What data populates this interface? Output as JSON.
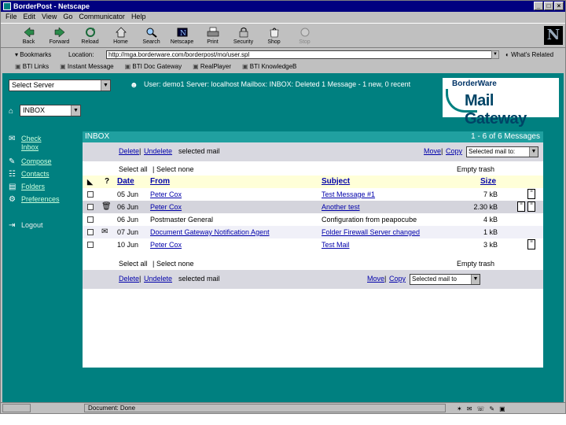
{
  "window": {
    "title": "BorderPost - Netscape"
  },
  "menubar": [
    "File",
    "Edit",
    "View",
    "Go",
    "Communicator",
    "Help"
  ],
  "toolbar": [
    {
      "label": "Back",
      "icon": "back-arrow-icon"
    },
    {
      "label": "Forward",
      "icon": "forward-arrow-icon"
    },
    {
      "label": "Reload",
      "icon": "reload-icon"
    },
    {
      "label": "Home",
      "icon": "home-icon"
    },
    {
      "label": "Search",
      "icon": "search-icon"
    },
    {
      "label": "Netscape",
      "icon": "netscape-icon"
    },
    {
      "label": "Print",
      "icon": "print-icon"
    },
    {
      "label": "Security",
      "icon": "security-icon"
    },
    {
      "label": "Shop",
      "icon": "shop-icon"
    },
    {
      "label": "Stop",
      "icon": "stop-icon",
      "disabled": true
    }
  ],
  "location": {
    "bookmarks": "Bookmarks",
    "label": "Location:",
    "url": "http://mga.borderware.com/borderpost/mo/user.spl",
    "whats_related": "What's Related"
  },
  "personal_bar": [
    "BTI Links",
    "Instant Message",
    "BTI Doc Gateway",
    "RealPlayer",
    "BTI KnowledgeB"
  ],
  "left": {
    "server_select": "Select Server",
    "folder_select": "INBOX",
    "nav": [
      {
        "label": "Check Inbox",
        "icon": "mailbox-icon"
      },
      {
        "label": "Compose",
        "icon": "compose-icon"
      },
      {
        "label": "Contacts",
        "icon": "contacts-icon"
      },
      {
        "label": "Folders",
        "icon": "folders-icon"
      },
      {
        "label": "Preferences",
        "icon": "preferences-icon"
      },
      {
        "label": "Logout",
        "icon": "logout-icon"
      }
    ]
  },
  "userinfo": "User: demo1 Server: localhost Mailbox: INBOX: Deleted 1 Message - 1 new, 0 recent",
  "logo": {
    "top": "BorderWare",
    "main": "Mail Gateway"
  },
  "inbox": {
    "title": "INBOX",
    "range": "1 - 6 of 6 Messages",
    "delete": "Delete",
    "undelete": "Undelete",
    "selected_mail": "selected mail",
    "move": "Move",
    "copy": "Copy",
    "target_select": "Selected mail to:",
    "target_select_bottom": "Selected mail to",
    "select_all": "Select all",
    "select_none": "Select none",
    "empty_trash": "Empty trash",
    "columns": {
      "date": "Date",
      "from": "From",
      "subject": "Subject",
      "size": "Size",
      "flag": "?"
    },
    "messages": [
      {
        "date": "05 Jun",
        "from": "Peter Cox",
        "subject": "Test Message #1",
        "size": "7 kB",
        "attach": 1,
        "highlight": false
      },
      {
        "date": "06 Jun",
        "from": "Peter Cox",
        "subject": "Another test",
        "size": "2.30 kB",
        "attach": 2,
        "highlight": true
      },
      {
        "date": "06 Jun",
        "from": "Postmaster General",
        "subject": "Configuration from peapocube",
        "size": "4 kB",
        "attach": 0,
        "highlight": false
      },
      {
        "date": "07 Jun",
        "from": "Document Gateway Notification Agent",
        "subject": "Folder Firewall Server changed",
        "size": "1 kB",
        "attach": 0,
        "highlight": false
      },
      {
        "date": "10 Jun",
        "from": "Peter Cox",
        "subject": "Test Mail",
        "size": "3 kB",
        "attach": 1,
        "highlight": false
      }
    ]
  },
  "status": {
    "text": "Document: Done"
  }
}
